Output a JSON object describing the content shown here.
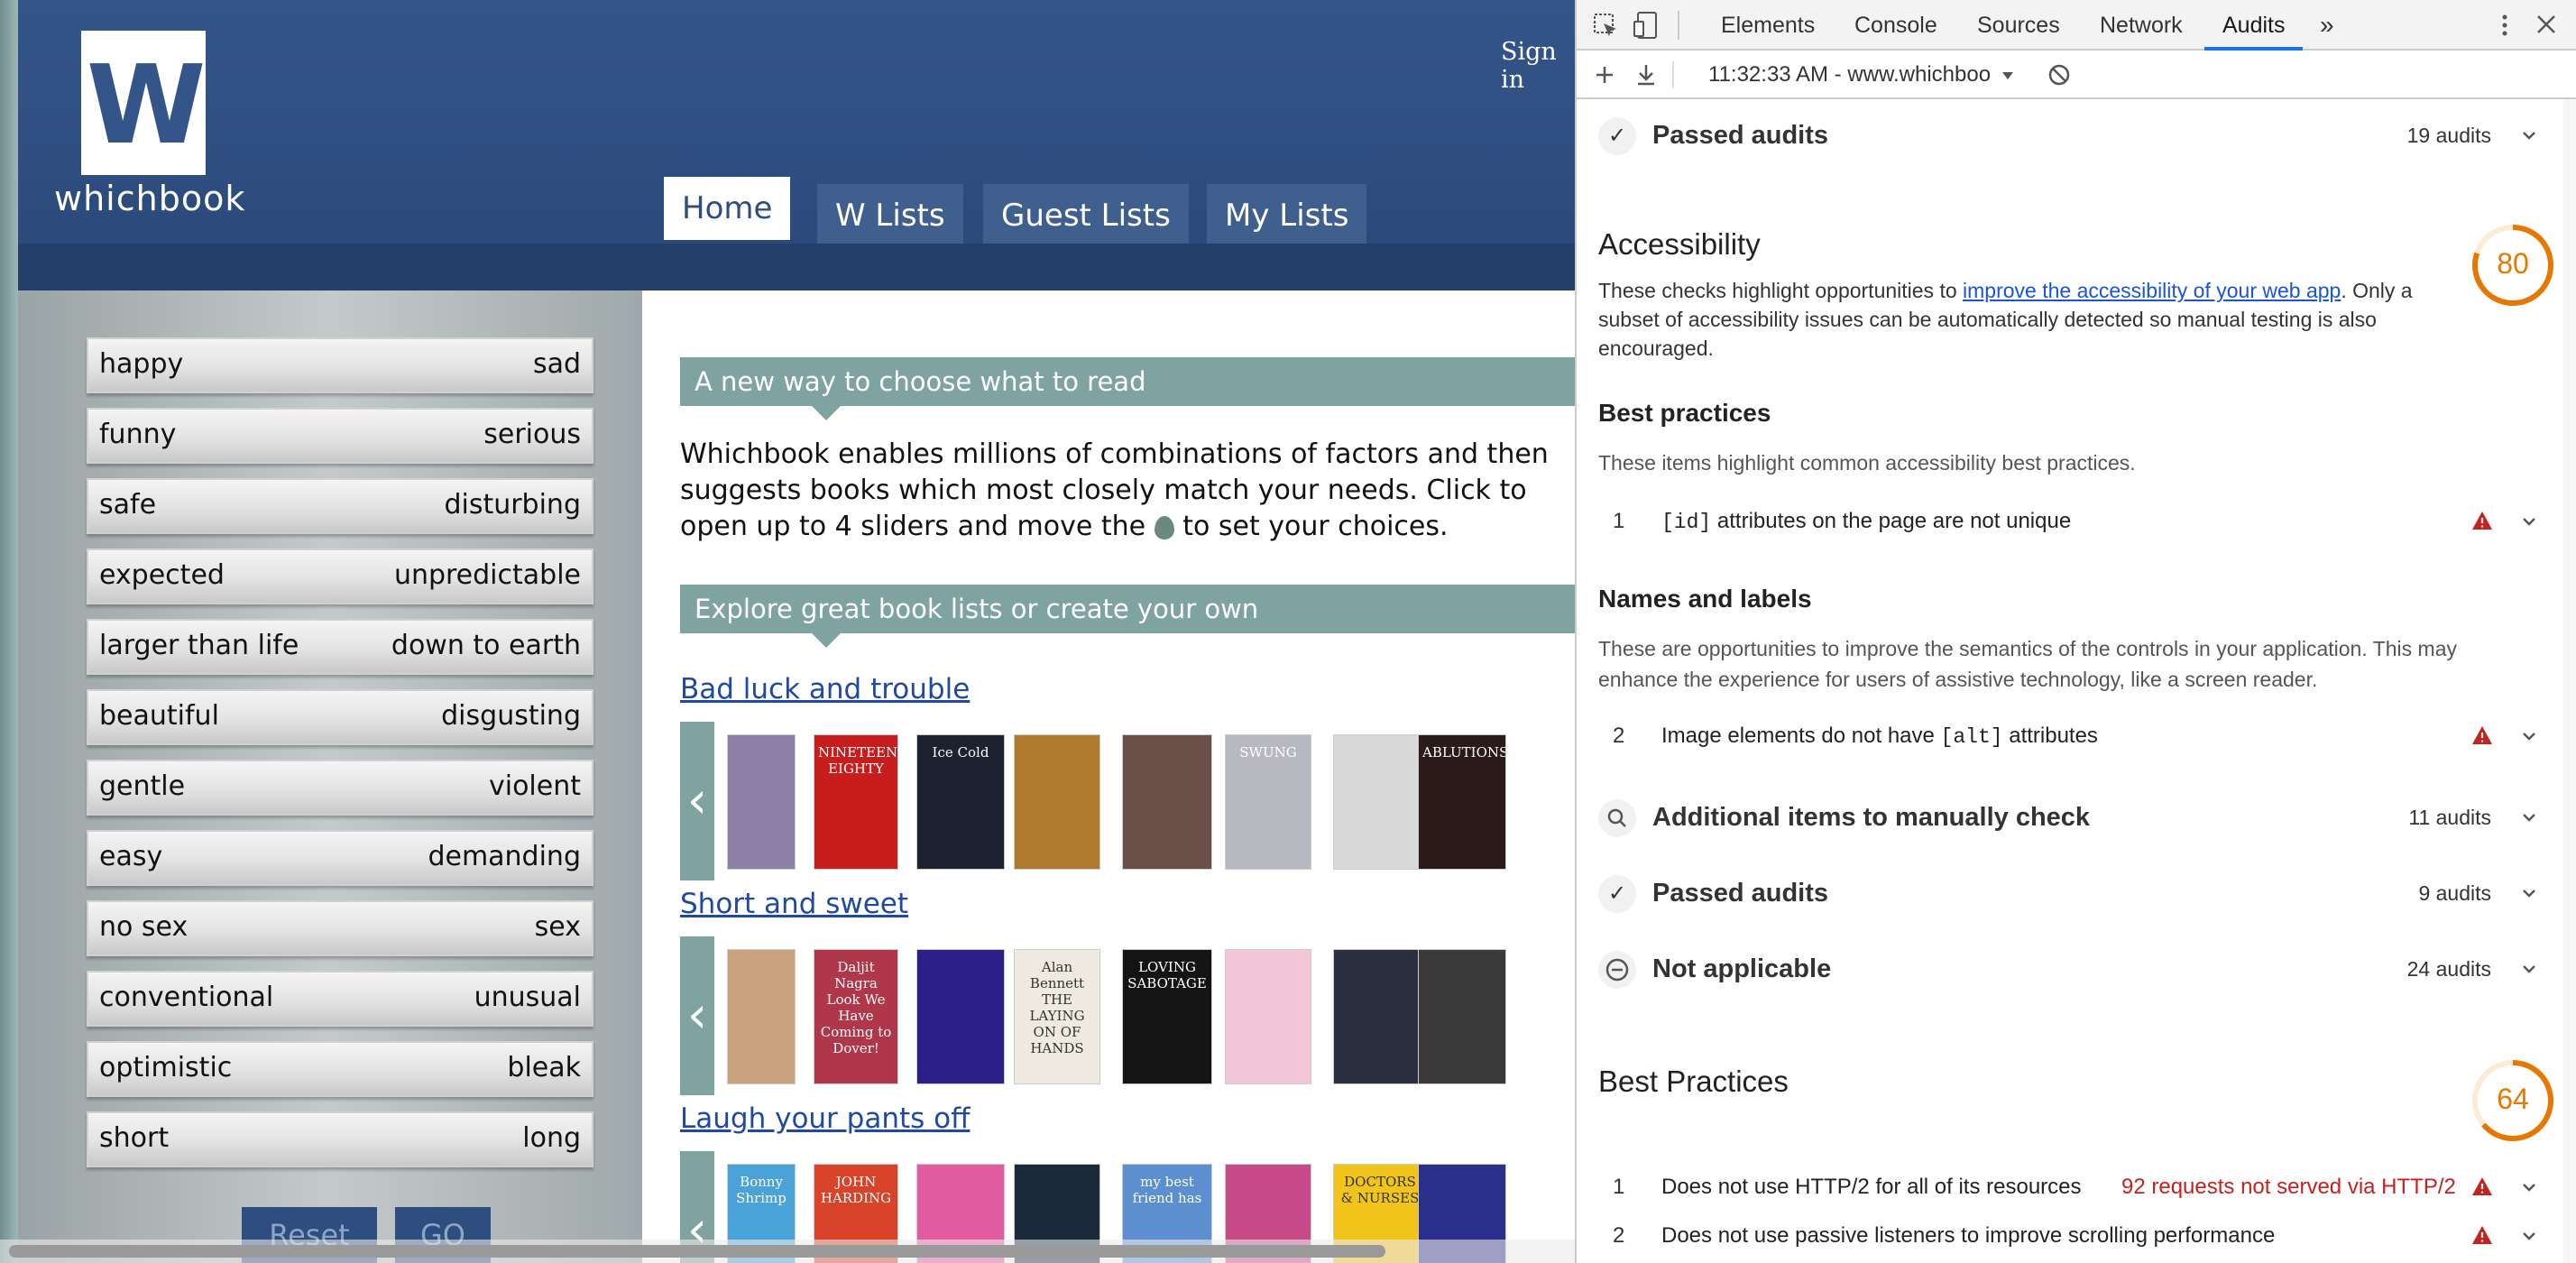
{
  "site": {
    "logo_letter": "W",
    "logo_word": "whichbook",
    "sign_in": "Sign in",
    "nav": [
      "Home",
      "W Lists",
      "Guest Lists",
      "My Lists"
    ],
    "sliders": [
      {
        "left": "happy",
        "right": "sad"
      },
      {
        "left": "funny",
        "right": "serious"
      },
      {
        "left": "safe",
        "right": "disturbing"
      },
      {
        "left": "expected",
        "right": "unpredictable"
      },
      {
        "left": "larger than life",
        "right": "down to earth"
      },
      {
        "left": "beautiful",
        "right": "disgusting"
      },
      {
        "left": "gentle",
        "right": "violent"
      },
      {
        "left": "easy",
        "right": "demanding"
      },
      {
        "left": "no sex",
        "right": "sex"
      },
      {
        "left": "conventional",
        "right": "unusual"
      },
      {
        "left": "optimistic",
        "right": "bleak"
      },
      {
        "left": "short",
        "right": "long"
      }
    ],
    "reset_label": "Reset",
    "go_label": "GO",
    "band1": "A new way to choose what to read",
    "intro_1": "Whichbook enables millions of combinations of factors and then suggests books which most closely match your needs. Click to open up to 4 sliders and move the",
    "intro_2": "to set your choices.",
    "band2": "Explore great book lists or create your own",
    "lists": [
      {
        "title": "Bad luck and trouble",
        "covers": [
          {
            "text": "",
            "bg": "#8c7fa8"
          },
          {
            "text": "NINETEEN EIGHTY",
            "bg": "#c81d1d"
          },
          {
            "text": "Ice Cold",
            "bg": "#1c2230"
          },
          {
            "text": "",
            "bg": "#b07a2c"
          },
          {
            "text": "",
            "bg": "#6a5048"
          },
          {
            "text": "SWUNG",
            "bg": "#b8b8c0"
          },
          {
            "text": "",
            "bg": "#d8d8d8"
          },
          {
            "text": "ABLUTIONS",
            "bg": "#2a1a1a"
          }
        ]
      },
      {
        "title": "Short and sweet",
        "covers": [
          {
            "text": "",
            "bg": "#c9a27e"
          },
          {
            "text": "Daljit Nagra Look We Have Coming to Dover!",
            "bg": "#b0364a"
          },
          {
            "text": "",
            "bg": "#2c1f8a"
          },
          {
            "text": "Alan Bennett THE LAYING ON OF HANDS",
            "bg": "#eeeadf"
          },
          {
            "text": "LOVING SABOTAGE",
            "bg": "#141414"
          },
          {
            "text": "",
            "bg": "#f2c6d6"
          },
          {
            "text": "",
            "bg": "#2a2e3e"
          },
          {
            "text": "",
            "bg": "#3a3a3a"
          }
        ]
      },
      {
        "title": "Laugh your pants off",
        "covers": [
          {
            "text": "Bonny Shrimp",
            "bg": "#4aa3d8"
          },
          {
            "text": "JOHN HARDING",
            "bg": "#d9432a"
          },
          {
            "text": "",
            "bg": "#e25aa0"
          },
          {
            "text": "",
            "bg": "#1b2a3a"
          },
          {
            "text": "my best friend has",
            "bg": "#5b8fd0"
          },
          {
            "text": "",
            "bg": "#c94a88"
          },
          {
            "text": "DOCTORS & NURSES",
            "bg": "#f0c419"
          },
          {
            "text": "",
            "bg": "#2a2f8c"
          }
        ]
      }
    ]
  },
  "devtools": {
    "tabs": [
      "Elements",
      "Console",
      "Sources",
      "Network",
      "Audits"
    ],
    "more": "»",
    "report_label": "11:32:33 AM - www.whichboo",
    "passed_top": {
      "title": "Passed audits",
      "count": "19 audits"
    },
    "accessibility": {
      "title": "Accessibility",
      "score": "80",
      "score_value": 0.8,
      "desc_1": "These checks highlight opportunities to ",
      "desc_link": "improve the accessibility of your web app",
      "desc_2": ". Only a subset of accessibility issues can be automatically detected so manual testing is also encouraged."
    },
    "best_practices_sub": {
      "title": "Best practices",
      "desc": "These items highlight common accessibility best practices.",
      "audit_num": "1",
      "audit_code": "[id]",
      "audit_text": " attributes on the page are not unique"
    },
    "names_labels": {
      "title": "Names and labels",
      "desc": "These are opportunities to improve the semantics of the controls in your application. This may enhance the experience for users of assistive technology, like a screen reader.",
      "audit_num": "2",
      "audit_text_1": "Image elements do not have ",
      "audit_code": "[alt]",
      "audit_text_2": " attributes"
    },
    "manual": {
      "title": "Additional items to manually check",
      "count": "11 audits"
    },
    "passed": {
      "title": "Passed audits",
      "count": "9 audits"
    },
    "not_applicable": {
      "title": "Not applicable",
      "count": "24 audits"
    },
    "best_practices": {
      "title": "Best Practices",
      "score": "64",
      "score_value": 0.64,
      "audits": [
        {
          "num": "1",
          "text": "Does not use HTTP/2 for all of its resources",
          "detail": "92 requests not served via HTTP/2"
        },
        {
          "num": "2",
          "text": "Does not use passive listeners to improve scrolling performance",
          "detail": ""
        }
      ]
    },
    "colors": {
      "accent": "#1a73e8",
      "score_average": "#e67700",
      "fail": "#c5221f"
    }
  }
}
